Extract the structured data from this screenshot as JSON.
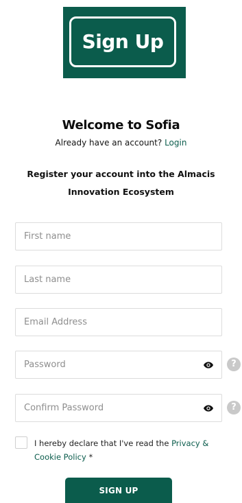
{
  "banner": {
    "title": "Sign Up",
    "bg_color": "#0b5c4c"
  },
  "header": {
    "welcome": "Welcome to Sofia",
    "have_account": "Already have an account?",
    "login_link": "Login",
    "register_line1": "Register your account into the Almacis",
    "register_line2": "Innovation Ecosystem"
  },
  "form": {
    "first_name": {
      "placeholder": "First name",
      "value": ""
    },
    "last_name": {
      "placeholder": "Last name",
      "value": ""
    },
    "email": {
      "placeholder": "Email Address",
      "value": ""
    },
    "password": {
      "placeholder": "Password",
      "value": "",
      "icon": "eye-icon",
      "help_icon": "help-icon",
      "help_glyph": "?"
    },
    "confirm_password": {
      "placeholder": "Confirm Password",
      "value": "",
      "icon": "eye-icon",
      "help_icon": "help-icon",
      "help_glyph": "?"
    }
  },
  "consent": {
    "checked": false,
    "text": "I hereby declare that I've read the",
    "policy_link": "Privacy & Cookie Policy",
    "required_mark": "*"
  },
  "submit": {
    "label": "SIGN UP"
  },
  "colors": {
    "accent": "#0b5c4c",
    "border": "#dcdcdc",
    "placeholder": "#8e8e8e",
    "help_icon": "#c9c9c9"
  }
}
